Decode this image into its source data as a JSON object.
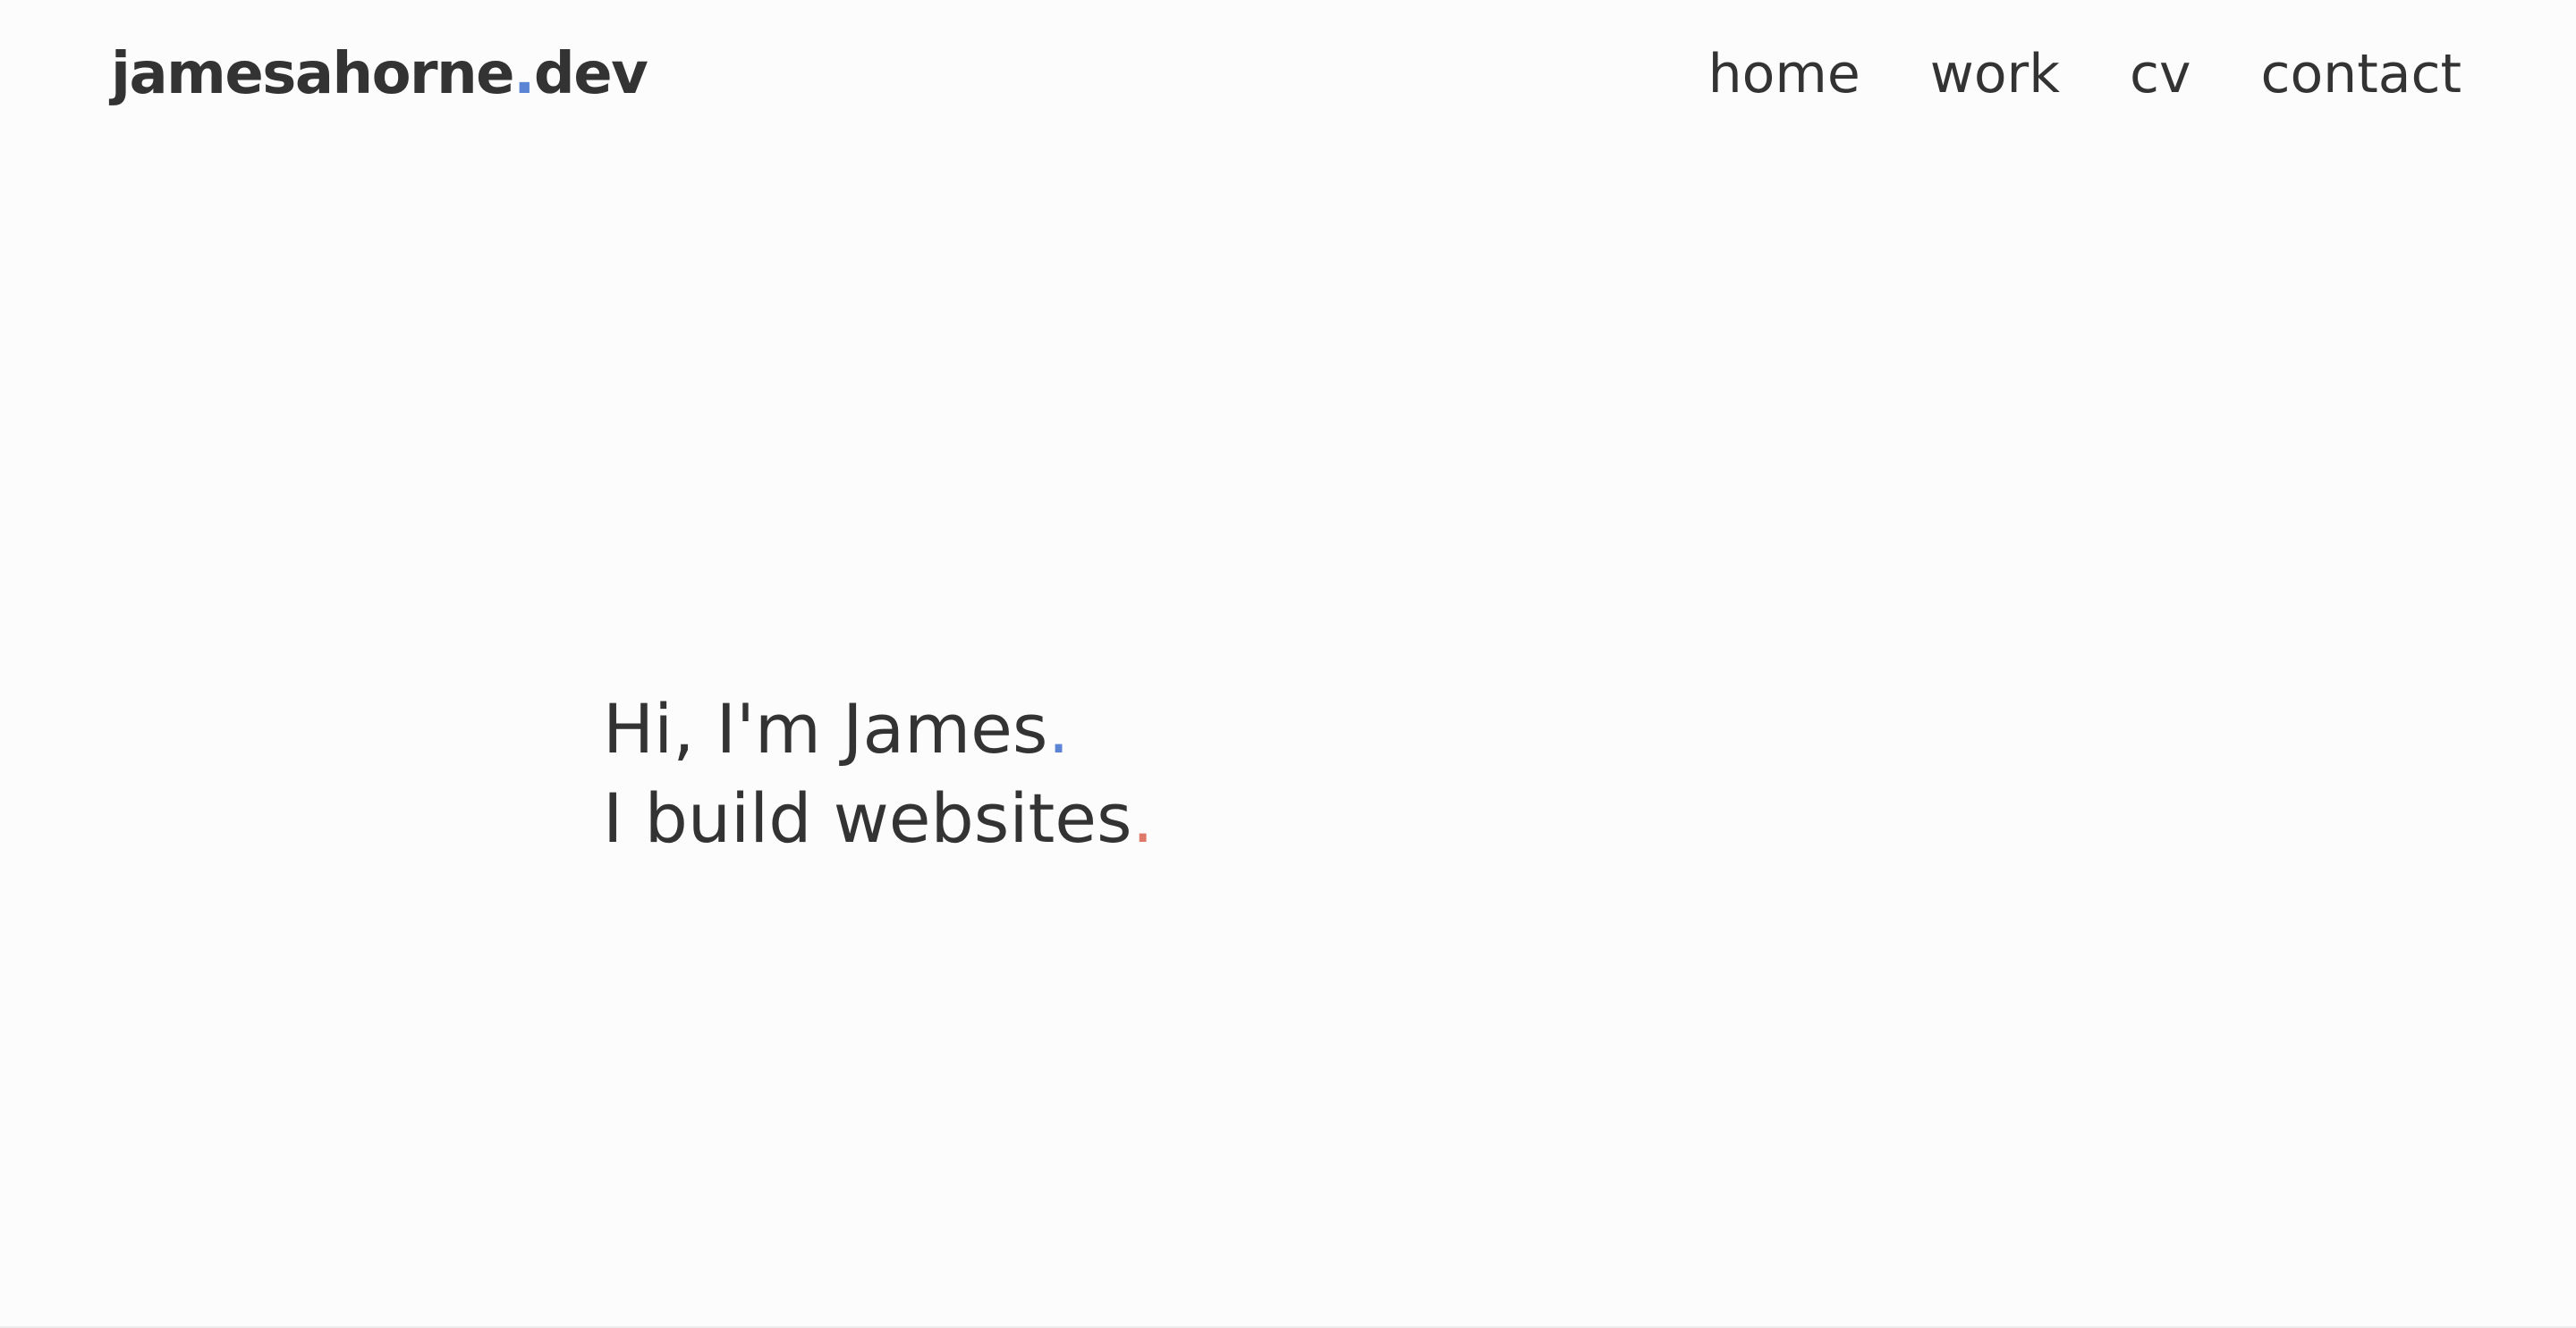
{
  "header": {
    "logo": {
      "name": "jamesahorne",
      "dot": ".",
      "tld": "dev"
    },
    "nav": [
      {
        "label": "home"
      },
      {
        "label": "work"
      },
      {
        "label": "cv"
      },
      {
        "label": "contact"
      }
    ]
  },
  "hero": {
    "line1": {
      "text": "Hi, I'm James",
      "punct": "."
    },
    "line2": {
      "text": "I build websites",
      "punct": "."
    }
  },
  "colors": {
    "text": "#333333",
    "background": "#fcfcfc",
    "accent_blue": "#5b84d4",
    "accent_red": "#de7868"
  }
}
